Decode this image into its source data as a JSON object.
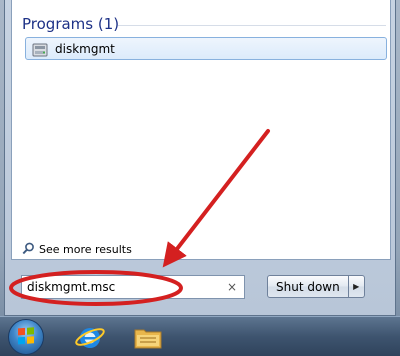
{
  "results": {
    "section_title": "Programs (1)",
    "items": [
      {
        "label": "diskmgmt",
        "icon": "disk-management-icon"
      }
    ],
    "see_more_label": "See more results"
  },
  "search": {
    "value": "diskmgmt.msc",
    "clear_icon": "×"
  },
  "shutdown": {
    "label": "Shut down",
    "arrow": "▶"
  },
  "annotation": {
    "color": "#d42020"
  },
  "taskbar": {
    "icons": [
      "windows-start-orb-icon",
      "internet-explorer-icon",
      "file-explorer-icon"
    ]
  }
}
